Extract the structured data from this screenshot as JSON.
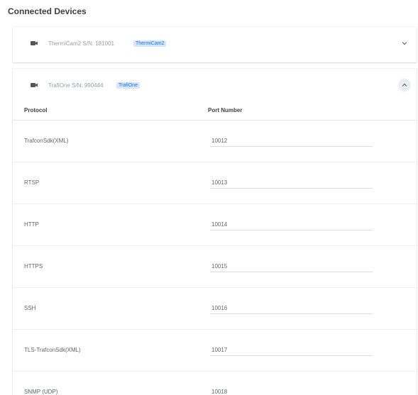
{
  "title": "Connected Devices",
  "devices": [
    {
      "name": "ThermiCam2 S/N: 181001",
      "badge": "ThermiCam2",
      "icon": "camera-icon",
      "expanded": false
    },
    {
      "name": "TrafiOne S/N: 990444",
      "badge": "TrafiOne",
      "icon": "camera-icon",
      "expanded": true
    }
  ],
  "table": {
    "headers": {
      "protocol": "Protocol",
      "port": "Port Number"
    },
    "rows": [
      {
        "protocol": "TrafconSdk(XML)",
        "port": "10012"
      },
      {
        "protocol": "RTSP",
        "port": "10013"
      },
      {
        "protocol": "HTTP",
        "port": "10014"
      },
      {
        "protocol": "HTTPS",
        "port": "10015"
      },
      {
        "protocol": "SSH",
        "port": "10016"
      },
      {
        "protocol": "TLS-TrafconSdk(XML)",
        "port": "10017"
      },
      {
        "protocol": "SNMP (UDP)",
        "port": "10018"
      }
    ]
  },
  "colors": {
    "badge_bg": "#d6e6fb",
    "badge_text": "#1a73e8",
    "muted_text": "#9aa0a6"
  }
}
